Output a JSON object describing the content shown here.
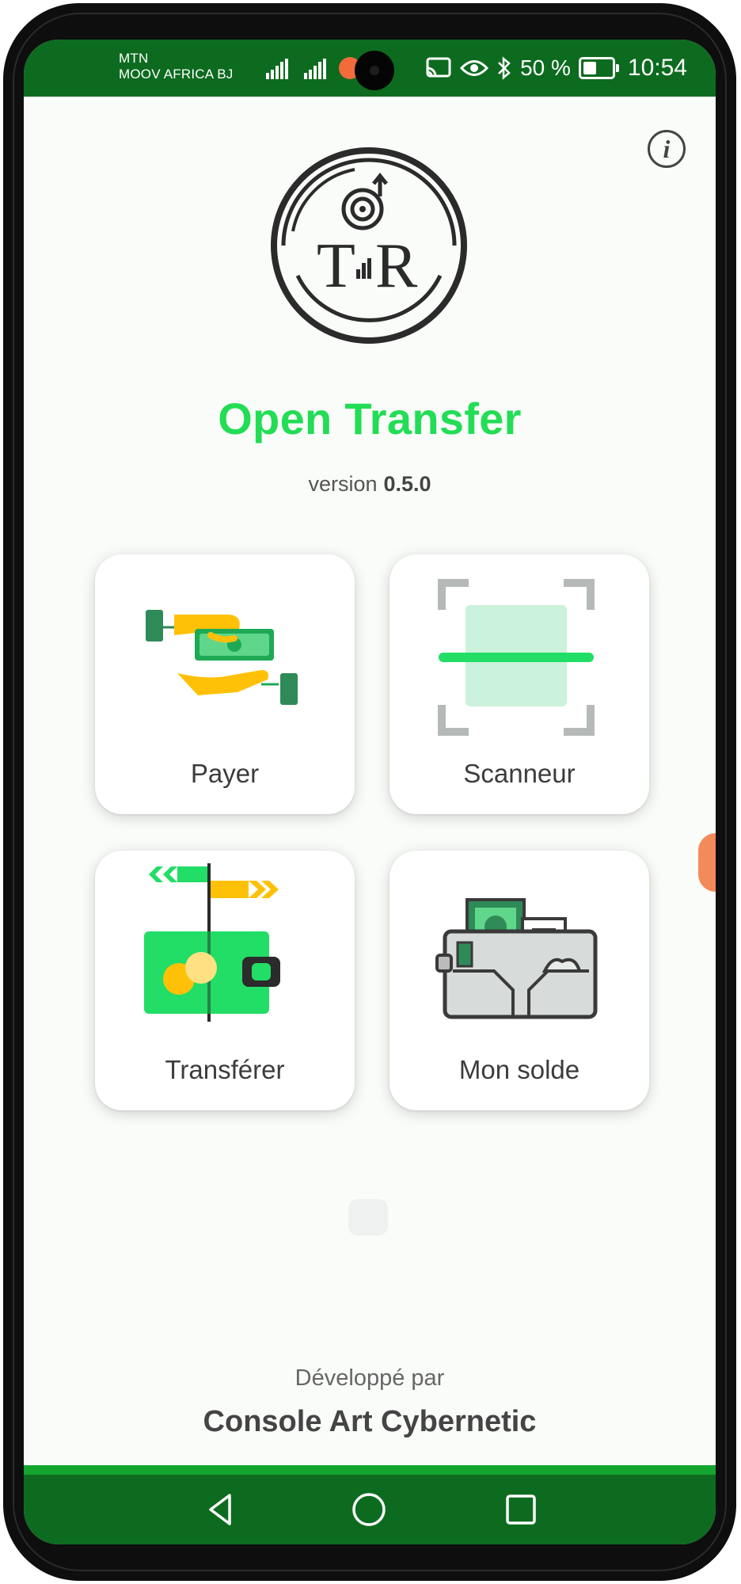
{
  "status_bar": {
    "carrier_1": "MTN",
    "carrier_2": "MOOV AFRICA BJ",
    "battery_percent": "50 %",
    "time": "10:54",
    "icons": [
      "signal-icon",
      "signal-icon",
      "notification-icon",
      "cast-icon",
      "eye-icon",
      "bluetooth-icon",
      "battery-icon"
    ]
  },
  "header": {
    "info_icon": "info-icon",
    "info_glyph": "i",
    "logo_icon": "open-transfer-logo"
  },
  "app": {
    "title": "Open Transfer",
    "version_label": "version",
    "version_number": "0.5.0"
  },
  "menu": {
    "items": [
      {
        "label": "Payer",
        "icon": "hands-exchange-money-icon"
      },
      {
        "label": "Scanneur",
        "icon": "qr-scanner-icon"
      },
      {
        "label": "Transférer",
        "icon": "wallet-transfer-icon"
      },
      {
        "label": "Mon solde",
        "icon": "wallet-balance-icon"
      }
    ]
  },
  "footer": {
    "developed_by": "Développé par",
    "developer": "Console Art Cybernetic"
  },
  "nav_bar": {
    "buttons": [
      "back-icon",
      "home-icon",
      "recents-icon"
    ]
  },
  "colors": {
    "status_bar": "#0d6b1f",
    "title_green": "#22dd55",
    "background": "#f9fcf8",
    "accent_yellow": "#ffc107"
  }
}
